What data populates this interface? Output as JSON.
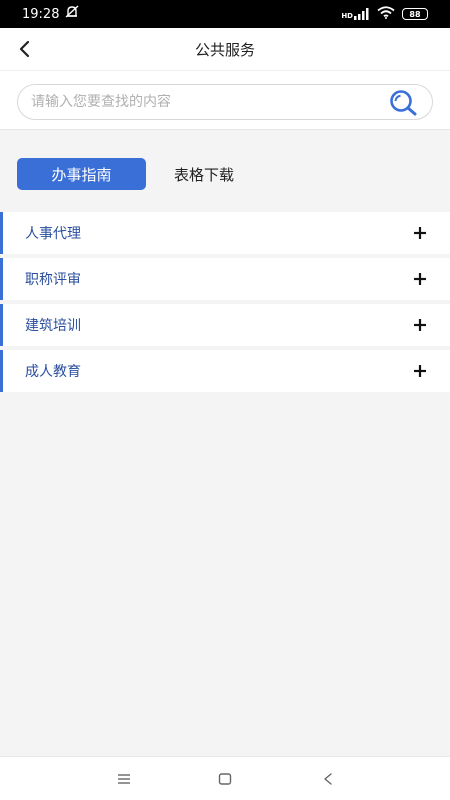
{
  "status_bar": {
    "time": "19:28",
    "network": "HD",
    "battery": "88"
  },
  "header": {
    "title": "公共服务",
    "back_icon": "chevron-left-icon"
  },
  "search": {
    "placeholder": "请输入您要查找的内容",
    "value": "",
    "icon": "search-icon"
  },
  "tabs": [
    {
      "label": "办事指南",
      "active": true
    },
    {
      "label": "表格下载",
      "active": false
    }
  ],
  "list": {
    "items": [
      {
        "label": "人事代理"
      },
      {
        "label": "职称评审"
      },
      {
        "label": "建筑培训"
      },
      {
        "label": "成人教育"
      }
    ],
    "expand_icon": "plus-icon"
  },
  "colors": {
    "accent": "#3a6fd8",
    "item_text": "#2b4f9e",
    "background": "#f4f4f4"
  },
  "nav_bar": {
    "icons": [
      "menu-icon",
      "home-square-icon",
      "back-triangle-icon"
    ]
  }
}
